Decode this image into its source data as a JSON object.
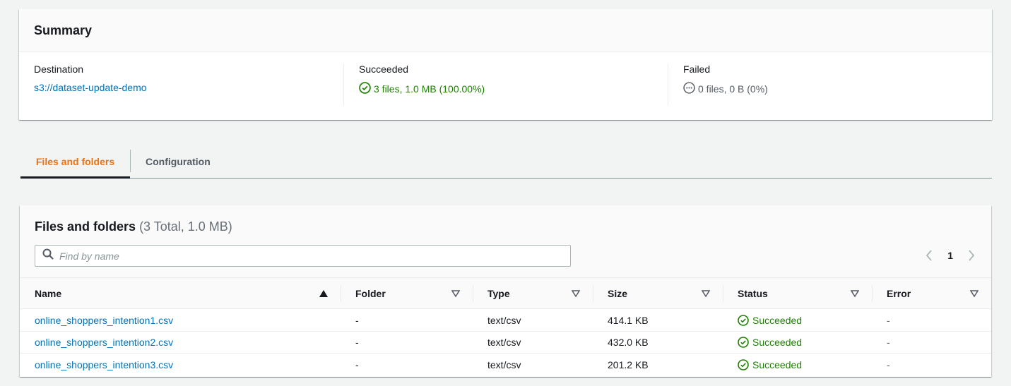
{
  "summary": {
    "title": "Summary",
    "destination_label": "Destination",
    "destination_value": "s3://dataset-update-demo",
    "succeeded_label": "Succeeded",
    "succeeded_value": "3 files, 1.0 MB (100.00%)",
    "failed_label": "Failed",
    "failed_value": "0 files, 0 B (0%)"
  },
  "tabs": [
    {
      "label": "Files and folders",
      "active": true
    },
    {
      "label": "Configuration",
      "active": false
    }
  ],
  "files": {
    "title": "Files and folders",
    "count": "(3 Total, 1.0 MB)",
    "search_placeholder": "Find by name",
    "current_page": "1",
    "columns": [
      "Name",
      "Folder",
      "Type",
      "Size",
      "Status",
      "Error"
    ],
    "rows": [
      {
        "name": "online_shoppers_intention1.csv",
        "folder": "-",
        "type": "text/csv",
        "size": "414.1 KB",
        "status": "Succeeded",
        "error": "-"
      },
      {
        "name": "online_shoppers_intention2.csv",
        "folder": "-",
        "type": "text/csv",
        "size": "432.0 KB",
        "status": "Succeeded",
        "error": "-"
      },
      {
        "name": "online_shoppers_intention3.csv",
        "folder": "-",
        "type": "text/csv",
        "size": "201.2 KB",
        "status": "Succeeded",
        "error": "-"
      }
    ]
  },
  "colors": {
    "link": "#0073bb",
    "success": "#1d8102",
    "active_tab": "#ec7211",
    "icons": {
      "success": "check-circle-icon",
      "failed": "ellipsis-circle-icon",
      "search": "search-icon",
      "sort": "caret-icon",
      "prev": "chevron-left-icon",
      "next": "chevron-right-icon"
    }
  }
}
